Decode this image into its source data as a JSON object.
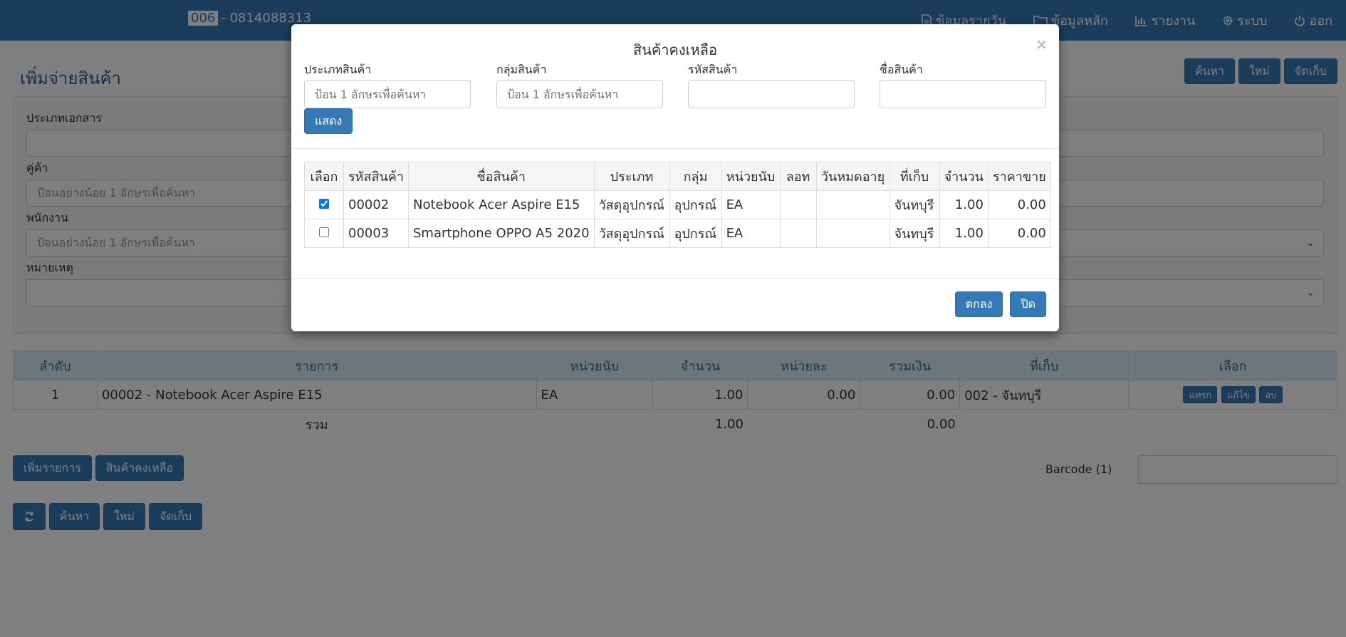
{
  "navbar": {
    "code": "006",
    "phone": "- 0814088313",
    "menu": [
      {
        "icon": "file-icon",
        "label": "ข้อมูลรายวัน"
      },
      {
        "icon": "folder-icon",
        "label": "ข้อมูลหลัก"
      },
      {
        "icon": "bar-chart-icon",
        "label": "รายงาน"
      },
      {
        "icon": "gear-icon",
        "label": "ระบบ"
      },
      {
        "icon": "power-icon",
        "label": "ออก"
      }
    ]
  },
  "page": {
    "title": "เพิ่มจ่ายสินค้า",
    "actions": {
      "search": "ค้นหา",
      "new": "ใหม่",
      "save": "จัดเก็บ"
    },
    "form": {
      "doc_type_label": "ประเภทเอกสาร",
      "partner_label": "คู่ค้า",
      "partner_placeholder": "ป้อนอย่างน้อย 1 อักษรเพื่อค้นหา",
      "employee_label": "พนักงาน",
      "employee_placeholder": "ป้อนอย่างน้อย 1 อักษรเพื่อค้นหา",
      "note_label": "หมายเหตุ"
    },
    "items_table": {
      "headers": [
        "ลำดับ",
        "รายการ",
        "หน่วยนับ",
        "จำนวน",
        "หน่วยละ",
        "รวมเงิน",
        "ที่เก็บ",
        "เลือก"
      ],
      "rows": [
        {
          "no": "1",
          "item": "00002 - Notebook Acer Aspire E15",
          "unit": "EA",
          "qty": "1.00",
          "price": "0.00",
          "total": "0.00",
          "location": "002 - จันทบุรี"
        }
      ],
      "row_actions": {
        "insert": "แทรก",
        "edit": "แก้ไข",
        "delete": "ลบ"
      },
      "total_label": "รวม",
      "total_qty": "1.00",
      "total_amount": "0.00"
    },
    "buttons": {
      "add_item": "เพิ่มรายการ",
      "stock": "สินค้าคงเหลือ"
    },
    "barcode_label": "Barcode (1)",
    "tools": {
      "search": "ค้นหา",
      "new": "ใหม่",
      "save": "จัดเก็บ"
    }
  },
  "modal": {
    "title": "สินค้าคงเหลือ",
    "close": "×",
    "filters": [
      {
        "label": "ประเภทสินค้า",
        "placeholder": "ป้อน 1 อักษรเพื่อค้นหา"
      },
      {
        "label": "กลุ่มสินค้า",
        "placeholder": "ป้อน 1 อักษรเพื่อค้นหา"
      },
      {
        "label": "รหัสสินค้า",
        "placeholder": ""
      },
      {
        "label": "ชื่อสินค้า",
        "placeholder": ""
      }
    ],
    "show_button": "แสดง",
    "table": {
      "headers": [
        "เลือก",
        "รหัสสินค้า",
        "ชื่อสินค้า",
        "ประเภท",
        "กลุ่ม",
        "หน่วยนับ",
        "ลอท",
        "วันหมดอายุ",
        "ที่เก็บ",
        "จำนวน",
        "ราคาขาย"
      ],
      "rows": [
        {
          "checked": true,
          "code": "00002",
          "name": "Notebook Acer Aspire E15",
          "type": "วัสดุอุปกรณ์",
          "group": "อุปกรณ์",
          "unit": "EA",
          "lot": "",
          "expiry": "",
          "location": "จันทบุรี",
          "qty": "1.00",
          "price": "0.00"
        },
        {
          "checked": false,
          "code": "00003",
          "name": "Smartphone OPPO A5 2020",
          "type": "วัสดุอุปกรณ์",
          "group": "อุปกรณ์",
          "unit": "EA",
          "lot": "",
          "expiry": "",
          "location": "จันทบุรี",
          "qty": "1.00",
          "price": "0.00"
        }
      ]
    },
    "ok_button": "ตกลง",
    "close_button": "ปิด"
  },
  "colors": {
    "primary": "#337ab7",
    "header_bg": "#d9edf7",
    "header_text": "#31708f",
    "title": "#1f5d97"
  }
}
